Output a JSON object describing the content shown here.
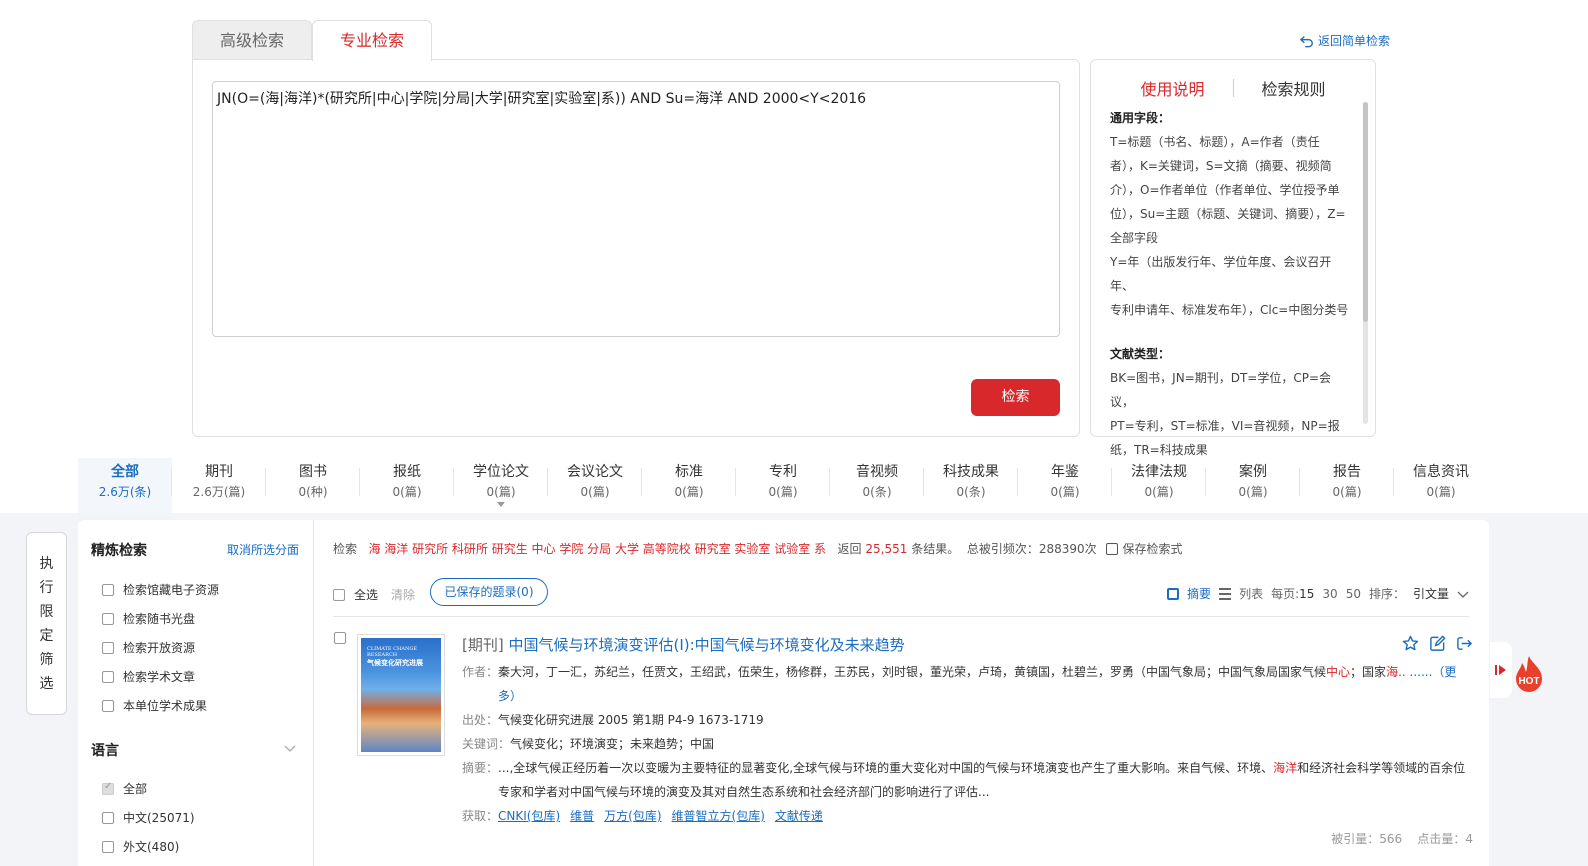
{
  "search_tabs": [
    {
      "label": "高级检索",
      "active": false
    },
    {
      "label": "专业检索",
      "active": true
    }
  ],
  "back_link": "返回简单检索",
  "query": {
    "value": "JN(O=(海|海洋)*(研究所|中心|学院|分局|大学|研究室|实验室|系)) AND Su=海洋 AND 2000<Y<2016",
    "search_button": "检索"
  },
  "help": {
    "tab_usage": "使用说明",
    "tab_rules": "检索规则",
    "fields_title": "通用字段：",
    "fields_lines": [
      "T=标题（书名、标题），A=作者（责任",
      "者），K=关键词，S=文摘（摘要、视频简",
      "介），O=作者单位（作者单位、学位授予单",
      "位），Su=主题（标题、关键词、摘要），Z=",
      "全部字段",
      "Y=年（出版发行年、学位年度、会议召开年、",
      "专利申请年、标准发布年），Clc=中图分类号"
    ],
    "types_title": "文献类型：",
    "types_lines": [
      "BK=图书，JN=期刊，DT=学位，CP=会议，",
      "PT=专利，ST=标准，VI=音视频，NP=报",
      "纸，TR=科技成果"
    ]
  },
  "types": [
    {
      "name": "全部",
      "count": "2.6万(条)",
      "active": true
    },
    {
      "name": "期刊",
      "count": "2.6万(篇)"
    },
    {
      "name": "图书",
      "count": "0(种)"
    },
    {
      "name": "报纸",
      "count": "0(篇)"
    },
    {
      "name": "学位论文",
      "count": "0(篇)"
    },
    {
      "name": "会议论文",
      "count": "0(篇)"
    },
    {
      "name": "标准",
      "count": "0(篇)"
    },
    {
      "name": "专利",
      "count": "0(篇)"
    },
    {
      "name": "音视频",
      "count": "0(条)"
    },
    {
      "name": "科技成果",
      "count": "0(条)"
    },
    {
      "name": "年鉴",
      "count": "0(篇)"
    },
    {
      "name": "法律法规",
      "count": "0(篇)"
    },
    {
      "name": "案例",
      "count": "0(篇)"
    },
    {
      "name": "报告",
      "count": "0(篇)"
    },
    {
      "name": "信息资讯",
      "count": "0(篇)"
    }
  ],
  "exec_filter": [
    "执",
    "行",
    "限",
    "定",
    "筛",
    "选"
  ],
  "refine": {
    "title": "精炼检索",
    "cancel": "取消所选分面",
    "options": [
      "检索馆藏电子资源",
      "检索随书光盘",
      "检索开放资源",
      "检索学术文章",
      "本单位学术成果"
    ],
    "lang_title": "语言",
    "lang_options": [
      {
        "label": "全部",
        "checked": true
      },
      {
        "label": "中文(25071)",
        "checked": false
      },
      {
        "label": "外文(480)",
        "checked": false
      }
    ]
  },
  "stats": {
    "prefix": "检索",
    "terms": "海 海洋 研究所 科研所 研究生 中心 学院 分局 大学 高等院校 研究室 实验室 试验室 系",
    "returned": "返回",
    "count": "25,551",
    "results_suffix": "条结果。",
    "cited": "总被引频次：288390次",
    "save": "保存检索式"
  },
  "toolbar": {
    "select_all": "全选",
    "clear": "清除",
    "saved": "已保存的题录(0)",
    "view_summary": "摘要",
    "view_list": "列表",
    "per_page_label": "每页:",
    "per_page": [
      "15",
      "30",
      "50"
    ],
    "sort_label": "排序：",
    "sort_value": "引文量"
  },
  "result": {
    "cover_en": "CLIMATE CHANGE RESEARCH",
    "cover_cn": "气候变化研究进展",
    "tag": "[期刊]",
    "title": "中国气候与环境演变评估(I):中国气候与环境变化及未来趋势",
    "authors_label": "作者：",
    "authors": "秦大河，丁一汇，苏纪兰，任贾文，王绍武，伍荣生，杨修群，王苏民，刘时银，董光荣，卢琦，黄镇国，杜碧兰，罗勇（中国气象局；中国气象局国家气候",
    "authors_hl1": "中心",
    "authors_mid": "；国家",
    "authors_hl2": "海..",
    "authors_more1": "......（更",
    "authors_more2": "多）",
    "source_label": "出处：",
    "source": "气候变化研究进展 2005 第1期 P4-9  1673-1719",
    "keywords_label": "关键词：",
    "keywords": "气候变化；环境演变；未来趋势；中国",
    "abstract_label": "摘要：",
    "abstract_a": "...,全球气候正经历着一次以变暖为主要特征的显著变化,全球气候与环境的重大变化对中国的气候与环境演变也产生了重大影响。来自气候、环境、",
    "abstract_hl": "海洋",
    "abstract_b": "和经济社会科学等领域的百余位",
    "abstract_c": "专家和学者对中国气候与环境的演变及其对自然生态系统和社会经济部门的影响进行了评估...",
    "access_label": "获取：",
    "access_links": [
      "CNKI(包库)",
      "维普",
      "万方(包库)",
      "维普智立方(包库)",
      "文献传递"
    ],
    "cited_by": "被引量：566",
    "clicks": "点击量：4"
  },
  "hot_label": "HOT"
}
